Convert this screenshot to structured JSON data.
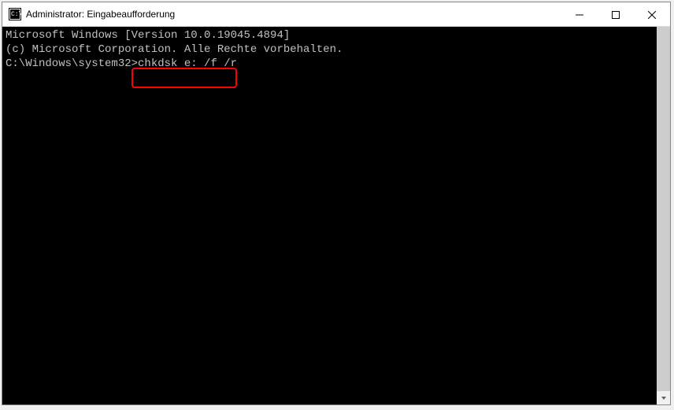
{
  "window": {
    "title": "Administrator: Eingabeaufforderung"
  },
  "terminal": {
    "line1": "Microsoft Windows [Version 10.0.19045.4894]",
    "line2": "(c) Microsoft Corporation. Alle Rechte vorbehalten.",
    "blank": "",
    "prompt": "C:\\Windows\\system32>",
    "command": "chkdsk e: /f /r"
  }
}
